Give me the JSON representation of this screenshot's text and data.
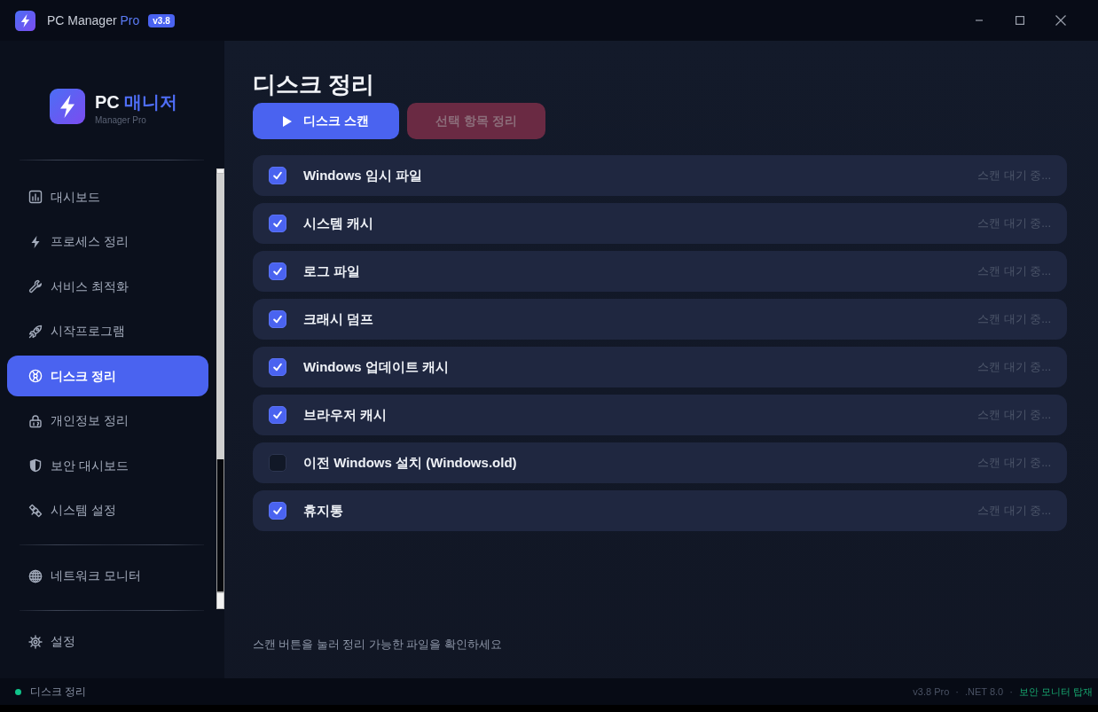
{
  "window": {
    "title": "PC Manager",
    "title_accent": "Pro",
    "version": "v3.8"
  },
  "sidebar": {
    "brand": {
      "name": "PC",
      "name_accent": "매니저",
      "subtitle": "Manager Pro"
    },
    "sections": [
      {
        "items": [
          {
            "label": "대시보드",
            "selected": false
          },
          {
            "label": "프로세스 정리",
            "selected": false
          },
          {
            "label": "서비스 최적화",
            "selected": false
          },
          {
            "label": "시작프로그램",
            "selected": false
          },
          {
            "label": "디스크 정리",
            "selected": true
          },
          {
            "label": "개인정보 정리",
            "selected": false
          },
          {
            "label": "보안 대시보드",
            "selected": false
          },
          {
            "label": "시스템 설정",
            "selected": false
          }
        ]
      },
      {
        "items": [
          {
            "label": "네트워크 모니터",
            "selected": false
          }
        ]
      },
      {
        "items": [
          {
            "label": "설정",
            "selected": false
          }
        ]
      }
    ]
  },
  "page": {
    "title": "디스크 정리",
    "buttons": [
      {
        "label": "디스크 스캔",
        "kind": "primary",
        "disabled": false
      },
      {
        "label": "선택 항목 정리",
        "kind": "danger",
        "disabled": true
      }
    ],
    "items": [
      {
        "label": "Windows 임시 파일",
        "checked": true,
        "status": "스캔 대기 중..."
      },
      {
        "label": "시스템 캐시",
        "checked": true,
        "status": "스캔 대기 중..."
      },
      {
        "label": "로그 파일",
        "checked": true,
        "status": "스캔 대기 중..."
      },
      {
        "label": "크래시 덤프",
        "checked": true,
        "status": "스캔 대기 중..."
      },
      {
        "label": "Windows 업데이트 캐시",
        "checked": true,
        "status": "스캔 대기 중..."
      },
      {
        "label": "브라우저 캐시",
        "checked": true,
        "status": "스캔 대기 중..."
      },
      {
        "label": "이전 Windows 설치 (Windows.old)",
        "checked": false,
        "status": "스캔 대기 중..."
      },
      {
        "label": "휴지통",
        "checked": true,
        "status": "스캔 대기 중..."
      }
    ],
    "hint": "스캔 버튼을 눌러 정리 가능한 파일을 확인하세요"
  },
  "status_bar": {
    "text": "디스크 정리",
    "info": [
      {
        "text": "v3.8 Pro",
        "kind": "muted"
      },
      {
        "text": "·",
        "kind": "separator"
      },
      {
        "text": ".NET 8.0",
        "kind": "muted"
      },
      {
        "text": "·",
        "kind": "separator"
      },
      {
        "text": "보안 모니터 탑재",
        "kind": "accent"
      }
    ]
  }
}
